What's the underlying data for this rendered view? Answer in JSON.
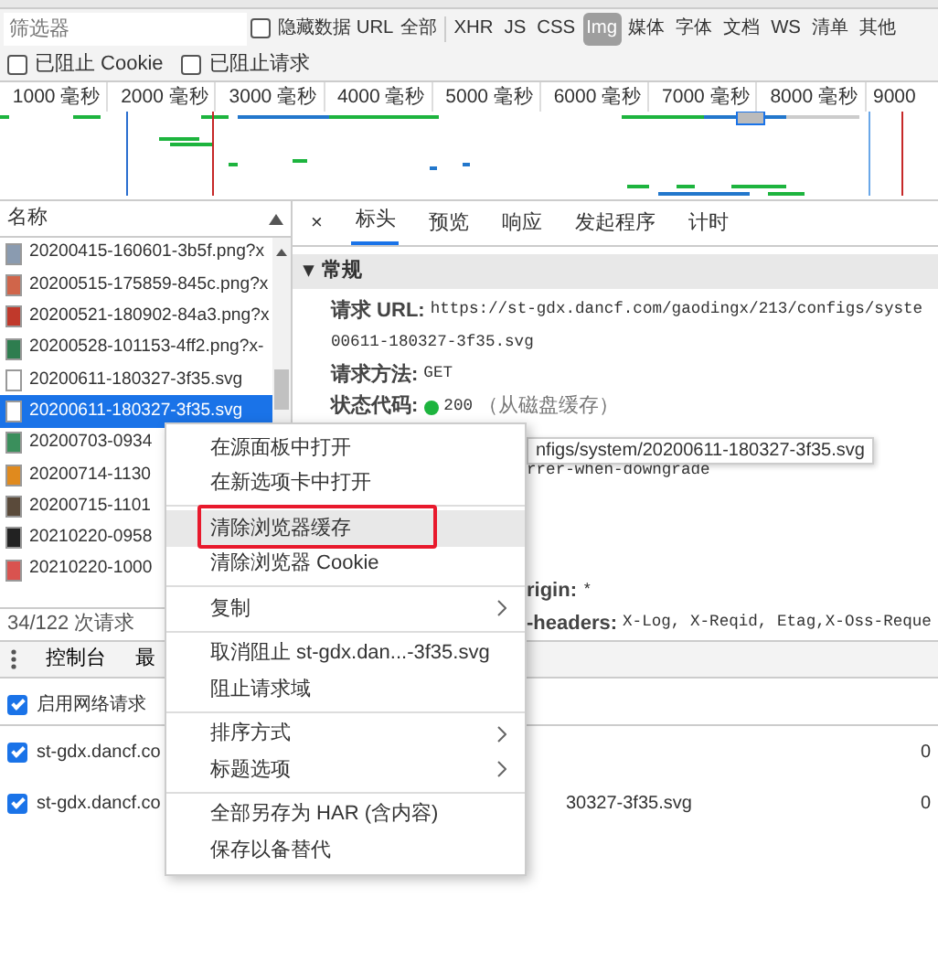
{
  "filter_bar": {
    "placeholder": "筛选器",
    "hide_data_url": {
      "label": "隐藏数据 URL",
      "checked": false
    },
    "types": [
      {
        "label": "全部",
        "selected": false
      },
      {
        "label": "XHR",
        "selected": false
      },
      {
        "label": "JS",
        "selected": false
      },
      {
        "label": "CSS",
        "selected": false
      },
      {
        "label": "Img",
        "selected": true
      },
      {
        "label": "媒体",
        "selected": false
      },
      {
        "label": "字体",
        "selected": false
      },
      {
        "label": "文档",
        "selected": false
      },
      {
        "label": "WS",
        "selected": false
      },
      {
        "label": "清单",
        "selected": false
      },
      {
        "label": "其他",
        "selected": false
      }
    ],
    "options": [
      {
        "label": "已阻止 Cookie",
        "checked": false
      },
      {
        "label": "已阻止请求",
        "checked": false
      }
    ]
  },
  "timeline": {
    "ticks": [
      "1000 毫秒",
      "2000 毫秒",
      "3000 毫秒",
      "4000 毫秒",
      "5000 毫秒",
      "6000 毫秒",
      "7000 毫秒",
      "8000 毫秒",
      "9000"
    ]
  },
  "request_list": {
    "header": "名称",
    "footer": "34/122 次请求",
    "rows": [
      {
        "name": "20200415-160601-3b5f.png?x",
        "kind": "image",
        "color": "#8a9bb0",
        "selected": false
      },
      {
        "name": "20200515-175859-845c.png?x",
        "kind": "image",
        "color": "#d0654a",
        "selected": false
      },
      {
        "name": "20200521-180902-84a3.png?x",
        "kind": "image",
        "color": "#c0392b",
        "selected": false
      },
      {
        "name": "20200528-101153-4ff2.png?x-",
        "kind": "image",
        "color": "#2e7d4f",
        "selected": false
      },
      {
        "name": "20200611-180327-3f35.svg",
        "kind": "svg",
        "selected": false
      },
      {
        "name": "20200611-180327-3f35.svg",
        "kind": "svg",
        "selected": true
      },
      {
        "name": "20200703-0934",
        "kind": "image",
        "color": "#3a8f5c",
        "selected": false
      },
      {
        "name": "20200714-1130",
        "kind": "image",
        "color": "#e08a1e",
        "selected": false
      },
      {
        "name": "20200715-1101",
        "kind": "image",
        "color": "#5a4a3a",
        "selected": false
      },
      {
        "name": "20210220-0958",
        "kind": "image",
        "color": "#222222",
        "selected": false
      },
      {
        "name": "20210220-1000",
        "kind": "image",
        "color": "#d9534f",
        "selected": false
      }
    ]
  },
  "details": {
    "close": "×",
    "tabs": [
      {
        "label": "标头",
        "selected": true
      },
      {
        "label": "预览",
        "selected": false
      },
      {
        "label": "响应",
        "selected": false
      },
      {
        "label": "发起程序",
        "selected": false
      },
      {
        "label": "计时",
        "selected": false
      }
    ],
    "section_caret": "▾",
    "section": "常规",
    "lines": [
      {
        "label": "请求 URL:",
        "value": "https://st-gdx.dancf.com/gaodingx/213/configs/syste"
      },
      {
        "value": "00611-180327-3f35.svg"
      },
      {
        "label": "请求方法:",
        "value": "GET"
      },
      {
        "kind": "status",
        "label": "状态代码:",
        "color": "#1db43e",
        "value": "200",
        "note": "（从磁盘缓存）"
      }
    ],
    "tooltip": "nfigs/system/20200611-180327-3f35.svg",
    "referrer_fragment": {
      "value": "rrer-when-downgrade"
    },
    "response_fragments": [
      {
        "label": "rigin:",
        "value": "*"
      },
      {
        "label": "-headers:",
        "value": "X-Log, X-Reqid, Etag,X-Oss-Reque"
      }
    ]
  },
  "drawer": {
    "tabs": [
      "控制台",
      "最"
    ],
    "enable": {
      "label": "启用网络请求",
      "checked": true
    },
    "rows": [
      {
        "pattern": "st-gdx.dancf.co",
        "checked": true,
        "tail": "",
        "size": "0"
      },
      {
        "pattern": "st-gdx.dancf.co",
        "checked": true,
        "tail": "30327-3f35.svg",
        "size": "0"
      }
    ]
  },
  "context_menu": {
    "groups": [
      [
        {
          "label": "在源面板中打开",
          "hovered": false,
          "annotated": false,
          "submenu": false
        },
        {
          "label": "在新选项卡中打开",
          "hovered": false,
          "annotated": false,
          "submenu": false
        }
      ],
      [
        {
          "label": "清除浏览器缓存",
          "hovered": true,
          "annotated": true,
          "submenu": false
        },
        {
          "label": "清除浏览器 Cookie",
          "hovered": false,
          "annotated": false,
          "submenu": false
        }
      ],
      [
        {
          "label": "复制",
          "hovered": false,
          "annotated": false,
          "submenu": true
        }
      ],
      [
        {
          "label": "取消阻止 st-gdx.dan...-3f35.svg",
          "hovered": false,
          "annotated": false,
          "submenu": false
        },
        {
          "label": "阻止请求域",
          "hovered": false,
          "annotated": false,
          "submenu": false
        }
      ],
      [
        {
          "label": "排序方式",
          "hovered": false,
          "annotated": false,
          "submenu": true
        },
        {
          "label": "标题选项",
          "hovered": false,
          "annotated": false,
          "submenu": true
        }
      ],
      [
        {
          "label": "全部另存为 HAR (含内容)",
          "hovered": false,
          "annotated": false,
          "submenu": false
        },
        {
          "label": "保存以备替代",
          "hovered": false,
          "annotated": false,
          "submenu": false
        }
      ]
    ]
  }
}
